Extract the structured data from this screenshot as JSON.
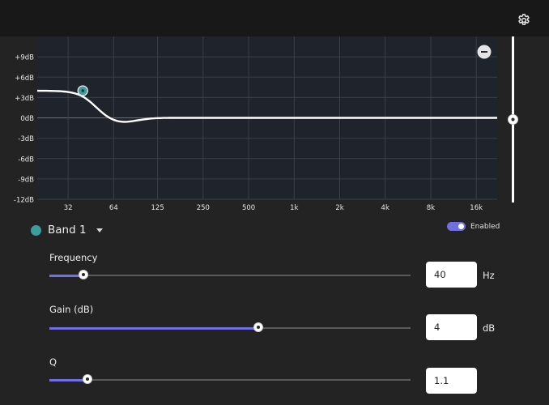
{
  "header": {
    "settings_icon": "gear-icon"
  },
  "graph": {
    "y_labels": [
      "+9dB",
      "+6dB",
      "+3dB",
      "0dB",
      "-3dB",
      "-6dB",
      "-9dB",
      "-12dB"
    ],
    "x_labels": [
      "32",
      "64",
      "125",
      "250",
      "500",
      "1k",
      "2k",
      "4k",
      "8k",
      "16k"
    ],
    "curve_color": "#ffffff",
    "grid_color": "#3a3f48",
    "background": "#1f232b",
    "remove_icon": "minus-circle-icon",
    "marker_color": "#3d9d9b"
  },
  "output_gain": {
    "level_db": 0
  },
  "band": {
    "label": "Band 1",
    "color": "#3d9d9b",
    "enabled_label": "Enabled",
    "enabled": true
  },
  "params": {
    "frequency": {
      "label": "Frequency",
      "value": "40",
      "unit": "Hz",
      "fraction": 0.094
    },
    "gain": {
      "label": "Gain (dB)",
      "value": "4",
      "unit": "dB",
      "fraction": 0.578
    },
    "q": {
      "label": "Q",
      "value": "1.1",
      "unit": "",
      "fraction": 0.106
    }
  },
  "accent": "#6f70e6"
}
